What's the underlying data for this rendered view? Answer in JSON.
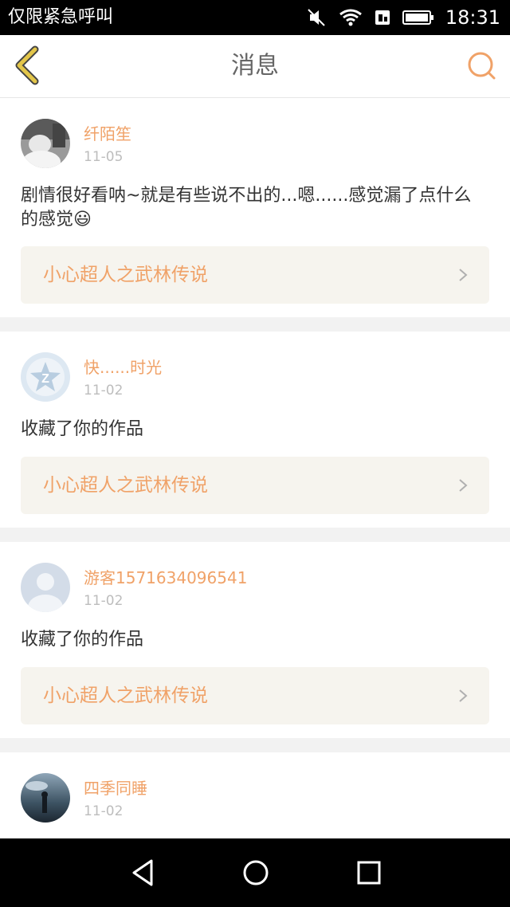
{
  "status_bar": {
    "left_text": "仅限紧急呼叫",
    "time": "18:31"
  },
  "header": {
    "title": "消息",
    "back_icon": "chevron-left-icon",
    "search_icon": "search-icon"
  },
  "colors": {
    "accent": "#f0a268",
    "card_link_bg": "#f6f4ee",
    "back_icon": "#e3c64a",
    "page_bg": "#f2f2f2"
  },
  "messages": [
    {
      "username": "纤陌笙",
      "date": "11-05",
      "content": "剧情很好看呐~就是有些说不出的...嗯......感觉漏了点什么的感觉😃",
      "work_title": "小心超人之武林传说"
    },
    {
      "username": "快......时光",
      "date": "11-02",
      "content": "收藏了你的作品",
      "work_title": "小心超人之武林传说"
    },
    {
      "username": "游客1571634096541",
      "date": "11-02",
      "content": "收藏了你的作品",
      "work_title": "小心超人之武林传说"
    },
    {
      "username": "四季同睡",
      "date": "11-02"
    }
  ],
  "nav_bar": {
    "back": "triangle-back-icon",
    "home": "circle-home-icon",
    "recents": "square-recents-icon"
  }
}
